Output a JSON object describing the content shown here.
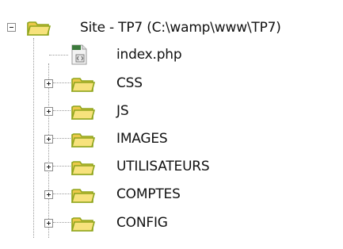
{
  "tree": {
    "root": {
      "label": "Site - TP7 (C:\\wamp\\www\\TP7)",
      "state": "expanded"
    },
    "file": {
      "label": "index.php",
      "icon": "php-file-icon"
    },
    "folders": [
      {
        "label": "CSS",
        "state": "collapsed"
      },
      {
        "label": "JS",
        "state": "collapsed"
      },
      {
        "label": "IMAGES",
        "state": "collapsed"
      },
      {
        "label": "UTILISATEURS",
        "state": "collapsed"
      },
      {
        "label": "COMPTES",
        "state": "collapsed"
      },
      {
        "label": "CONFIG",
        "state": "collapsed"
      }
    ]
  },
  "colors": {
    "folder_fill": "#f7e27c",
    "folder_stroke": "#8fa51c",
    "folder_tab": "#ecc94a"
  }
}
